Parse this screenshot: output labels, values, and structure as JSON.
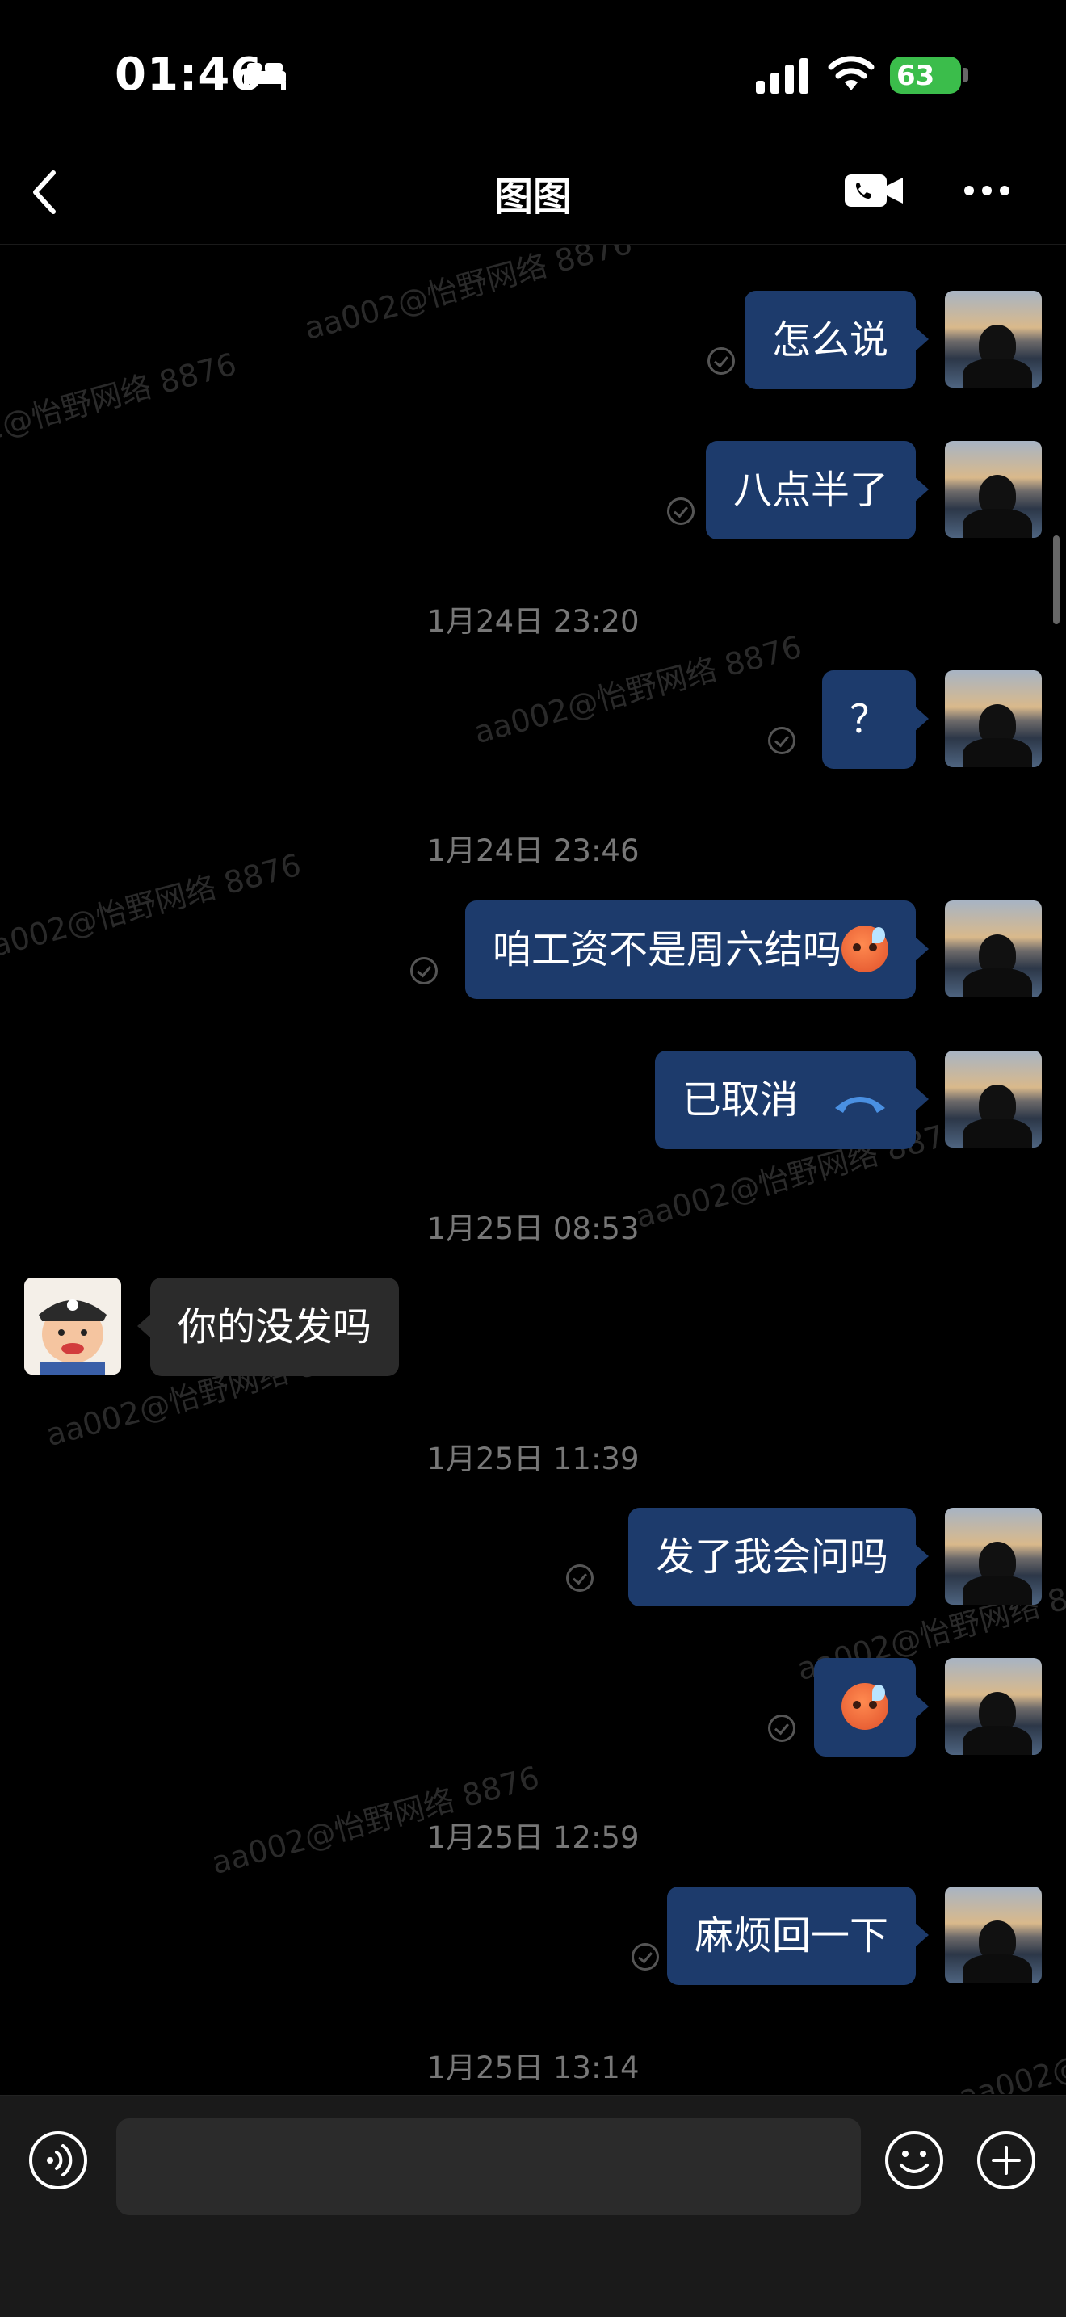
{
  "status_bar": {
    "time": "01:46",
    "battery": "63"
  },
  "header": {
    "title": "图图"
  },
  "watermark": "aa002@怡野网络 8876",
  "messages": [
    {
      "side": "right",
      "text": "怎么说"
    },
    {
      "side": "right",
      "text": "八点半了"
    },
    {
      "type": "timestamp",
      "text": "1月24日 23:20"
    },
    {
      "side": "right",
      "text": "？"
    },
    {
      "type": "timestamp",
      "text": "1月24日 23:46"
    },
    {
      "side": "right",
      "text": "咱工资不是周六结吗"
    },
    {
      "side": "right",
      "text": "已取消"
    },
    {
      "type": "timestamp",
      "text": "1月25日 08:53"
    },
    {
      "side": "left",
      "text": "你的没发吗"
    },
    {
      "type": "timestamp",
      "text": "1月25日 11:39"
    },
    {
      "side": "right",
      "text": "发了我会问吗"
    },
    {
      "side": "right",
      "text": ""
    },
    {
      "type": "timestamp",
      "text": "1月25日 12:59"
    },
    {
      "side": "right",
      "text": "麻烦回一下"
    },
    {
      "type": "timestamp",
      "text": "1月25日 13:14"
    }
  ],
  "colors": {
    "background": "#000000",
    "my_bubble": "#1d3b6c",
    "other_bubble": "#2b2b2b",
    "battery": "#3bbd4b"
  },
  "icons": [
    "back-icon",
    "video-call-icon",
    "more-icon",
    "voice-icon",
    "emoji-icon",
    "plus-icon",
    "phone-hangup-icon",
    "bed-icon",
    "signal-icon",
    "wifi-icon"
  ]
}
